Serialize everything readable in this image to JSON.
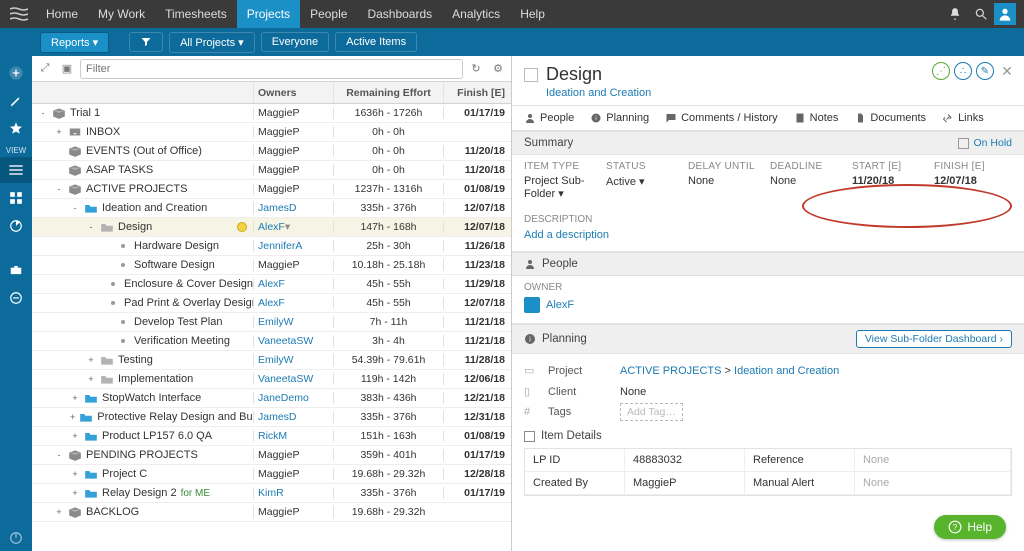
{
  "topnav": {
    "items": [
      "Home",
      "My Work",
      "Timesheets",
      "Projects",
      "People",
      "Dashboards",
      "Analytics",
      "Help"
    ],
    "active_index": 3
  },
  "filterbar": {
    "reports": "Reports ▾",
    "all_projects": "All Projects ▾",
    "everyone": "Everyone",
    "active_items": "Active Items"
  },
  "rail_view_label": "VIEW",
  "tree": {
    "search_placeholder": "Filter",
    "columns": {
      "owners": "Owners",
      "remaining": "Remaining Effort",
      "finish": "Finish [E]"
    },
    "rows": [
      {
        "indent": 0,
        "toggle": "-",
        "icon": "package",
        "name": "Trial 1",
        "owner": "MaggieP",
        "effort": "1636h - 1726h",
        "finish": "01/17/19"
      },
      {
        "indent": 1,
        "toggle": "+",
        "icon": "inbox",
        "name": "INBOX",
        "owner": "MaggieP",
        "effort": "0h - 0h",
        "finish": ""
      },
      {
        "indent": 1,
        "toggle": "",
        "icon": "package",
        "name": "EVENTS (Out of Office)",
        "owner": "MaggieP",
        "effort": "0h - 0h",
        "finish": "11/20/18"
      },
      {
        "indent": 1,
        "toggle": "",
        "icon": "package",
        "name": "ASAP TASKS",
        "owner": "MaggieP",
        "effort": "0h - 0h",
        "finish": "11/20/18"
      },
      {
        "indent": 1,
        "toggle": "-",
        "icon": "package",
        "name": "ACTIVE PROJECTS",
        "owner": "MaggieP",
        "effort": "1237h - 1316h",
        "finish": "01/08/19"
      },
      {
        "indent": 2,
        "toggle": "-",
        "icon": "folder-blue",
        "name": "Ideation and Creation",
        "owner": "JamesD",
        "owner_link": true,
        "effort": "335h - 376h",
        "finish": "12/07/18"
      },
      {
        "indent": 3,
        "toggle": "-",
        "icon": "folder-gray",
        "name": "Design",
        "owner": "AlexF",
        "owner_link": true,
        "owner_dd": true,
        "effort": "147h - 168h",
        "finish": "12/07/18",
        "selected": true,
        "dot": true
      },
      {
        "indent": 4,
        "toggle": "",
        "icon": "dot",
        "name": "Hardware Design",
        "owner": "JenniferA",
        "owner_link": true,
        "effort": "25h - 30h",
        "finish": "11/26/18"
      },
      {
        "indent": 4,
        "toggle": "",
        "icon": "dot",
        "name": "Software Design",
        "owner": "MaggieP",
        "effort": "10.18h - 25.18h",
        "finish": "11/23/18"
      },
      {
        "indent": 4,
        "toggle": "",
        "icon": "dot",
        "name": "Enclosure & Cover Design",
        "owner": "AlexF",
        "owner_link": true,
        "effort": "45h - 55h",
        "finish": "11/29/18"
      },
      {
        "indent": 4,
        "toggle": "",
        "icon": "dot",
        "name": "Pad Print & Overlay Design",
        "owner": "AlexF",
        "owner_link": true,
        "effort": "45h - 55h",
        "finish": "12/07/18"
      },
      {
        "indent": 4,
        "toggle": "",
        "icon": "dot",
        "name": "Develop Test Plan",
        "owner": "EmilyW",
        "owner_link": true,
        "effort": "7h - 11h",
        "finish": "11/21/18"
      },
      {
        "indent": 4,
        "toggle": "",
        "icon": "dot",
        "name": "Verification Meeting",
        "owner": "VaneetaSW",
        "owner_link": true,
        "effort": "3h - 4h",
        "finish": "11/21/18"
      },
      {
        "indent": 3,
        "toggle": "+",
        "icon": "folder-gray",
        "name": "Testing",
        "owner": "EmilyW",
        "owner_link": true,
        "effort": "54.39h - 79.61h",
        "finish": "11/28/18"
      },
      {
        "indent": 3,
        "toggle": "+",
        "icon": "folder-gray",
        "name": "Implementation",
        "owner": "VaneetaSW",
        "owner_link": true,
        "effort": "119h - 142h",
        "finish": "12/06/18"
      },
      {
        "indent": 2,
        "toggle": "+",
        "icon": "folder-blue",
        "name": "StopWatch Interface",
        "owner": "JaneDemo",
        "owner_link": true,
        "effort": "383h - 436h",
        "finish": "12/21/18"
      },
      {
        "indent": 2,
        "toggle": "+",
        "icon": "folder-blue",
        "name": "Protective Relay Design and Build",
        "owner": "JamesD",
        "owner_link": true,
        "effort": "335h - 376h",
        "finish": "12/31/18"
      },
      {
        "indent": 2,
        "toggle": "+",
        "icon": "folder-blue",
        "name": "Product LP157 6.0 QA",
        "owner": "RickM",
        "owner_link": true,
        "effort": "151h - 163h",
        "finish": "01/08/19"
      },
      {
        "indent": 1,
        "toggle": "-",
        "icon": "package",
        "name": "PENDING PROJECTS",
        "owner": "MaggieP",
        "effort": "359h - 401h",
        "finish": "01/17/19"
      },
      {
        "indent": 2,
        "toggle": "+",
        "icon": "folder-blue",
        "name": "Project C",
        "owner": "MaggieP",
        "effort": "19.68h - 29.32h",
        "finish": "12/28/18"
      },
      {
        "indent": 2,
        "toggle": "+",
        "icon": "folder-blue",
        "name": "Relay Design 2",
        "suffix": "for ME",
        "owner": "KimR",
        "owner_link": true,
        "effort": "335h - 376h",
        "finish": "01/17/19"
      },
      {
        "indent": 1,
        "toggle": "+",
        "icon": "package",
        "name": "BACKLOG",
        "owner": "MaggieP",
        "effort": "19.68h - 29.32h",
        "finish": ""
      }
    ]
  },
  "detail": {
    "title": "Design",
    "subtitle": "Ideation and Creation",
    "tabs": [
      "People",
      "Planning",
      "Comments / History",
      "Notes",
      "Documents",
      "Links"
    ],
    "summary": {
      "head": "Summary",
      "on_hold": "On Hold",
      "labels": [
        "ITEM TYPE",
        "STATUS",
        "DELAY UNTIL",
        "DEADLINE",
        "START [E]",
        "FINISH [E]"
      ],
      "values": {
        "item_type": "Project Sub-Folder ▾",
        "status": "Active ▾",
        "delay_until": "None",
        "deadline": "None",
        "start": "11/20/18",
        "finish": "12/07/18"
      }
    },
    "description_label": "DESCRIPTION",
    "description_add": "Add a description",
    "people_head": "People",
    "owner_label": "OWNER",
    "owner_name": "AlexF",
    "planning_head": "Planning",
    "planning_button": "View Sub-Folder Dashboard ›",
    "plan_project_label": "Project",
    "plan_project_path1": "ACTIVE PROJECTS",
    "plan_project_sep": " > ",
    "plan_project_path2": "Ideation and Creation",
    "plan_client_label": "Client",
    "plan_client_value": "None",
    "plan_tags_label": "Tags",
    "plan_tags_placeholder": "Add Tag…",
    "item_details_head": "Item Details",
    "item_details": {
      "lp_id_label": "LP ID",
      "lp_id": "48883032",
      "reference_label": "Reference",
      "reference": "None",
      "created_by_label": "Created By",
      "created_by": "MaggieP",
      "manual_alert_label": "Manual Alert",
      "manual_alert": "None"
    }
  },
  "help": "Help"
}
